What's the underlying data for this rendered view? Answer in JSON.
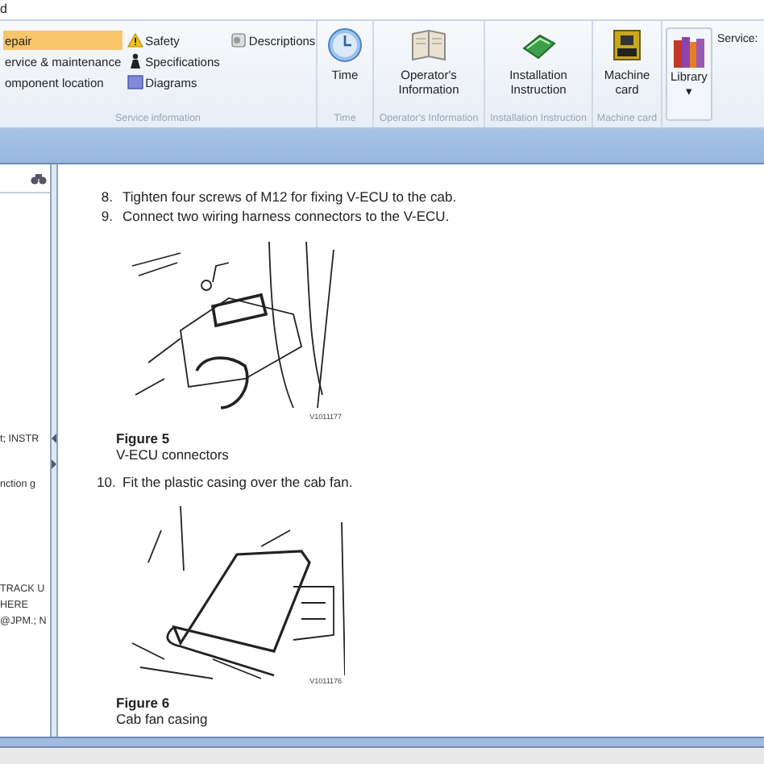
{
  "menu_tab": "d",
  "ribbon": {
    "list_group": {
      "label": "Service information",
      "columns": [
        [
          {
            "label": "epair",
            "selected": true
          },
          {
            "label": "ervice & maintenance",
            "selected": false
          },
          {
            "label": "omponent location",
            "selected": false
          }
        ],
        [
          {
            "label": "Safety",
            "selected": false
          },
          {
            "label": "Specifications",
            "selected": false
          },
          {
            "label": "Diagrams",
            "selected": false
          }
        ],
        [
          {
            "label": "Descriptions",
            "selected": false
          }
        ]
      ]
    },
    "button_groups": [
      {
        "button": "Time",
        "label": "Time"
      },
      {
        "button": "Operator's Information",
        "label": "Operator's Information"
      },
      {
        "button": "Installation Instruction",
        "label": "Installation Instruction"
      },
      {
        "button": "Machine card",
        "label": "Machine card"
      }
    ],
    "library": {
      "button": "Library",
      "caret": "▾"
    },
    "service_label": "Service:"
  },
  "sidebar": {
    "items": [
      "t; INSTR",
      "nction g",
      "TRACK U",
      "HERE",
      "@JPM.; N"
    ]
  },
  "document": {
    "blocks": [
      {
        "kind": "step",
        "number": "8.",
        "text": "Tighten four screws of M12 for fixing V-ECU to the cab."
      },
      {
        "kind": "step",
        "number": "9.",
        "text": "Connect two wiring harness connectors to the V-ECU."
      },
      {
        "kind": "figure",
        "image_id": "V1011177",
        "title": "Figure 5",
        "caption": "V-ECU connectors"
      },
      {
        "kind": "step",
        "number": "10.",
        "text": "Fit the plastic casing over the cab fan."
      },
      {
        "kind": "figure",
        "image_id": "V1011176",
        "title": "Figure 6",
        "caption": "Cab fan casing"
      }
    ]
  }
}
